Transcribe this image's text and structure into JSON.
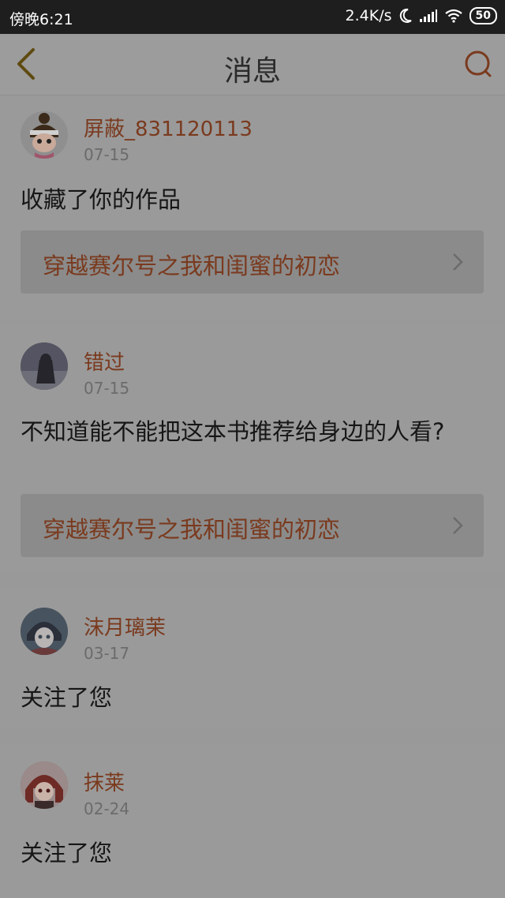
{
  "status_bar": {
    "time": "傍晚6:21",
    "speed": "2.4K/s",
    "battery": "50"
  },
  "header": {
    "title": "消息"
  },
  "colors": {
    "accent": "#c0602a",
    "overlay_bg": "#999999"
  },
  "messages": [
    {
      "user": "屏蔽_831120113",
      "date": "07-15",
      "text": "收藏了你的作品",
      "book": "穿越赛尔号之我和闺蜜的初恋"
    },
    {
      "user": "错过",
      "date": "07-15",
      "text": "不知道能不能把这本书推荐给身边的人看?",
      "book": "穿越赛尔号之我和闺蜜的初恋"
    },
    {
      "user": "沫月璃茉",
      "date": "03-17",
      "text": "关注了您"
    },
    {
      "user": "抹莱",
      "date": "02-24",
      "text": "关注了您"
    }
  ]
}
